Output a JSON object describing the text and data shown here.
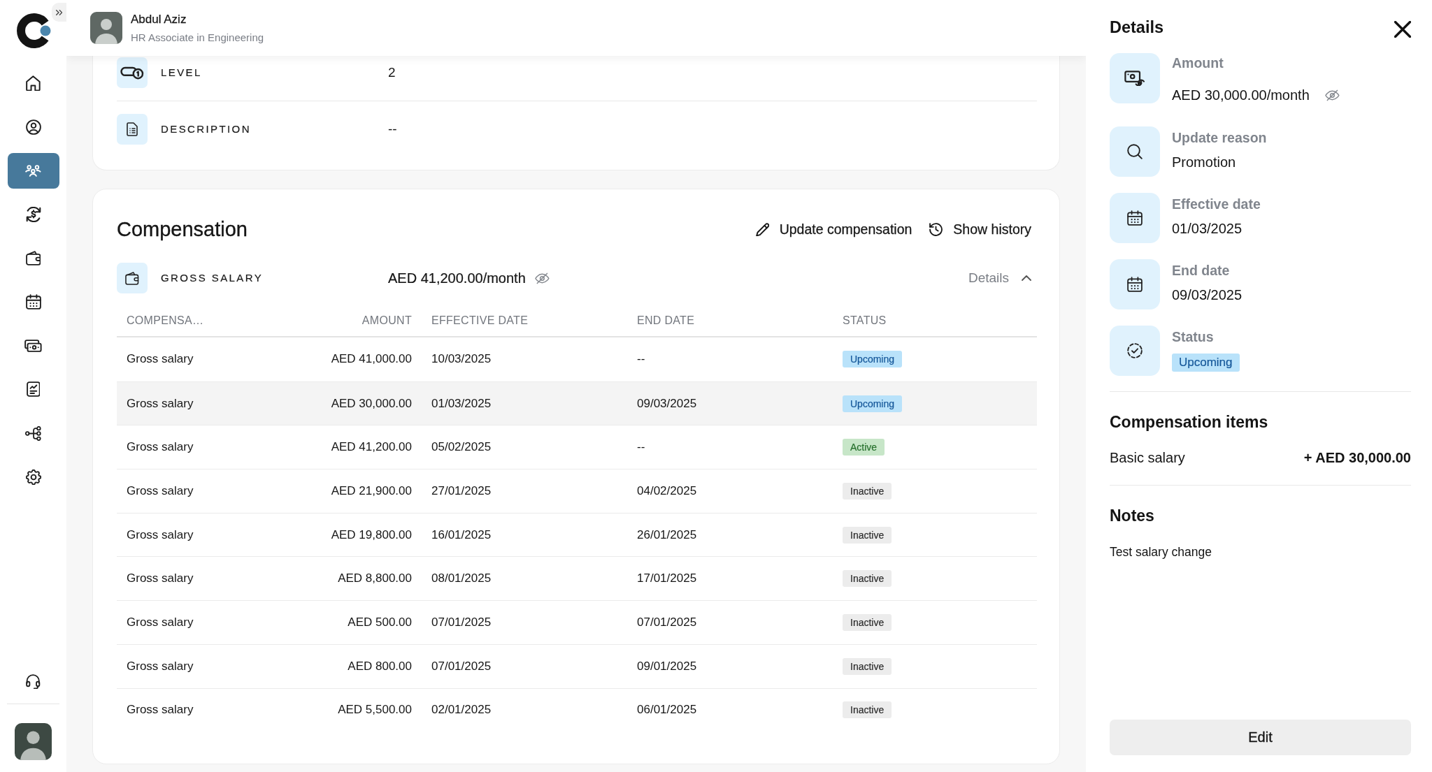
{
  "sidebar": {
    "items": [
      {
        "selected": false
      },
      {
        "selected": false
      },
      {
        "selected": true
      },
      {
        "selected": false
      },
      {
        "selected": false
      },
      {
        "selected": false
      },
      {
        "selected": false
      },
      {
        "selected": false
      },
      {
        "selected": false
      },
      {
        "selected": false
      }
    ]
  },
  "header": {
    "name": "Abdul Aziz",
    "subtitle": "HR Associate in Engineering"
  },
  "job_card": {
    "fields": [
      {
        "label": "LEVEL",
        "value": "2"
      },
      {
        "label": "DESCRIPTION",
        "value": "--"
      }
    ]
  },
  "compensation": {
    "title": "Compensation",
    "actions": [
      {
        "label": "Update compensation"
      },
      {
        "label": "Show history"
      }
    ],
    "summary": {
      "label": "GROSS SALARY",
      "value": "AED 41,200.00/month"
    },
    "details_toggle": {
      "label": "Details",
      "expanded": true
    },
    "table": {
      "columns": [
        "COMPENSA…",
        "AMOUNT",
        "EFFECTIVE DATE",
        "END DATE",
        "STATUS"
      ],
      "rows": [
        {
          "cells": [
            "Gross salary",
            "AED 41,000.00",
            "10/03/2025",
            "--"
          ],
          "status": {
            "label": "Upcoming",
            "kind": "upcoming"
          },
          "selected": false
        },
        {
          "cells": [
            "Gross salary",
            "AED 30,000.00",
            "01/03/2025",
            "09/03/2025"
          ],
          "status": {
            "label": "Upcoming",
            "kind": "upcoming"
          },
          "selected": true
        },
        {
          "cells": [
            "Gross salary",
            "AED 41,200.00",
            "05/02/2025",
            "--"
          ],
          "status": {
            "label": "Active",
            "kind": "active"
          },
          "selected": false
        },
        {
          "cells": [
            "Gross salary",
            "AED 21,900.00",
            "27/01/2025",
            "04/02/2025"
          ],
          "status": {
            "label": "Inactive",
            "kind": "inactive"
          },
          "selected": false
        },
        {
          "cells": [
            "Gross salary",
            "AED 19,800.00",
            "16/01/2025",
            "26/01/2025"
          ],
          "status": {
            "label": "Inactive",
            "kind": "inactive"
          },
          "selected": false
        },
        {
          "cells": [
            "Gross salary",
            "AED 8,800.00",
            "08/01/2025",
            "17/01/2025"
          ],
          "status": {
            "label": "Inactive",
            "kind": "inactive"
          },
          "selected": false
        },
        {
          "cells": [
            "Gross salary",
            "AED 500.00",
            "07/01/2025",
            "07/01/2025"
          ],
          "status": {
            "label": "Inactive",
            "kind": "inactive"
          },
          "selected": false
        },
        {
          "cells": [
            "Gross salary",
            "AED 800.00",
            "07/01/2025",
            "09/01/2025"
          ],
          "status": {
            "label": "Inactive",
            "kind": "inactive"
          },
          "selected": false
        },
        {
          "cells": [
            "Gross salary",
            "AED 5,500.00",
            "02/01/2025",
            "06/01/2025"
          ],
          "status": {
            "label": "Inactive",
            "kind": "inactive"
          },
          "selected": false
        }
      ]
    }
  },
  "details_panel": {
    "title": "Details",
    "fields": [
      {
        "kind": "amount",
        "label": "Amount",
        "value": "AED 30,000.00/month"
      },
      {
        "kind": "reason",
        "label": "Update reason",
        "value": "Promotion"
      },
      {
        "kind": "date",
        "label": "Effective date",
        "value": "01/03/2025"
      },
      {
        "kind": "date",
        "label": "End date",
        "value": "09/03/2025"
      },
      {
        "kind": "status",
        "label": "Status",
        "status": {
          "label": "Upcoming",
          "kind": "upcoming"
        }
      }
    ],
    "items_title": "Compensation items",
    "items": [
      {
        "name": "Basic salary",
        "amount": "+ AED 30,000.00"
      }
    ],
    "notes_title": "Notes",
    "notes": "Test salary change",
    "edit_button": "Edit"
  }
}
